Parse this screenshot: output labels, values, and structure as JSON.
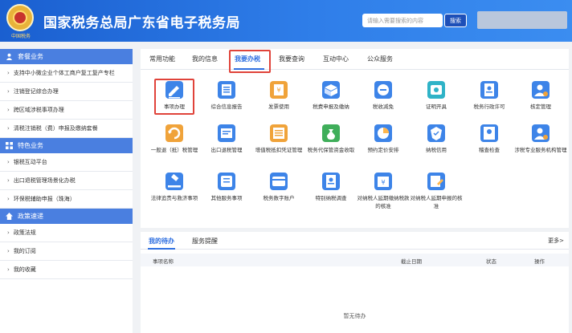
{
  "header": {
    "logo_text": "中国税务",
    "title": "国家税务总局广东省电子税务局",
    "search_placeholder": "请输入需要搜索的内容",
    "search_button": "搜索"
  },
  "sidebar": {
    "sections": [
      {
        "title": "套餐业务",
        "icon": "user-icon",
        "items": [
          "支持中小微企业个体工商户复工复产专栏",
          "注销登记综合办理",
          "跨区域涉税事项办理",
          "清税注销税（费）申报及缴纳套餐"
        ]
      },
      {
        "title": "特色业务",
        "icon": "grid-icon",
        "items": [
          "银税互动平台",
          "出口退税管理场景化办税",
          "环保税辅助申报（珠海）"
        ]
      },
      {
        "title": "政策速递",
        "icon": "home-icon",
        "items": [
          "政策法规",
          "我的订阅",
          "我的收藏"
        ]
      }
    ]
  },
  "tabs": [
    "常用功能",
    "我的信息",
    "我要办税",
    "我要查询",
    "互动中心",
    "公众服务"
  ],
  "grid": [
    {
      "label": "事项办理",
      "icon": "pen-icon",
      "color": "#3d84e8"
    },
    {
      "label": "综合信息报告",
      "icon": "report-icon",
      "color": "#3d84e8"
    },
    {
      "label": "发票使用",
      "icon": "invoice-icon",
      "color": "#f0a33a"
    },
    {
      "label": "税费申报及缴纳",
      "icon": "tax-box-icon",
      "color": "#3d84e8"
    },
    {
      "label": "税收减免",
      "icon": "reduction-icon",
      "color": "#3d84e8"
    },
    {
      "label": "证明开具",
      "icon": "certificate-icon",
      "color": "#2fb3c7"
    },
    {
      "label": "税务行政许可",
      "icon": "permit-icon",
      "color": "#3d84e8"
    },
    {
      "label": "核定管理",
      "icon": "manage-user-icon",
      "color": "#3d84e8"
    },
    {
      "label": "一般退（抵）税管理",
      "icon": "refund-icon",
      "color": "#f0a33a"
    },
    {
      "label": "出口退税管理",
      "icon": "export-icon",
      "color": "#3d84e8"
    },
    {
      "label": "增值税抵扣凭证管理",
      "icon": "voucher-icon",
      "color": "#f0a33a"
    },
    {
      "label": "税务代保管资金收取",
      "icon": "money-bag-icon",
      "color": "#3fae5a"
    },
    {
      "label": "预约定价安排",
      "icon": "pie-chart-icon",
      "color": "#3d84e8"
    },
    {
      "label": "纳税信用",
      "icon": "credit-icon",
      "color": "#3d84e8"
    },
    {
      "label": "稽查检查",
      "icon": "inspect-icon",
      "color": "#3d84e8"
    },
    {
      "label": "涉税专业服务机构管理",
      "icon": "agency-icon",
      "color": "#3d84e8"
    },
    {
      "label": "法律追责与救济事项",
      "icon": "gavel-icon",
      "color": "#3d84e8"
    },
    {
      "label": "其他服务事项",
      "icon": "service-icon",
      "color": "#3d84e8"
    },
    {
      "label": "税务数字账户",
      "icon": "account-icon",
      "color": "#3d84e8"
    },
    {
      "label": "特别纳税调查",
      "icon": "survey-icon",
      "color": "#3d84e8"
    },
    {
      "label": "对纳税人延期缴纳税款的核准",
      "icon": "delay-pay-icon",
      "color": "#3d84e8"
    },
    {
      "label": "对纳税人延期申报的核准",
      "icon": "delay-report-icon",
      "color": "#3d84e8"
    }
  ],
  "todo": {
    "tabs": [
      "我的待办",
      "服务提醒"
    ],
    "more": "更多>",
    "columns": [
      "事项名称",
      "截止日期",
      "状态",
      "操作"
    ],
    "empty": "暂无待办"
  }
}
